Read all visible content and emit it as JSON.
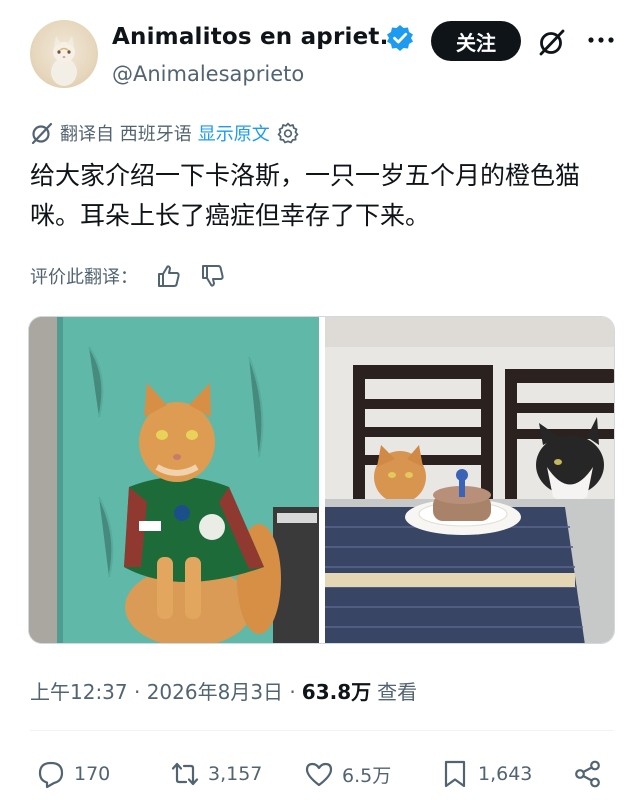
{
  "author": {
    "display_name": "Animalitos en apriet...",
    "handle": "@Animalesaprieto",
    "avatar_icon": "cat-avatar",
    "verified_icon": "verified-badge-icon",
    "follow_label": "关注"
  },
  "translation": {
    "prefix": "翻译自 西班牙语",
    "show_original": "显示原文",
    "rate_label": "评价此翻译："
  },
  "tweet": {
    "text": "给大家介绍一下卡洛斯，一只一岁五个月的橙色猫咪。耳朵上长了癌症但幸存了下来。"
  },
  "meta": {
    "time": "上午12:37 · 2026年8月3日 ·",
    "views": "63.8万",
    "views_label": "查看"
  },
  "actions": {
    "replies": "170",
    "reposts": "3,157",
    "likes": "6.5万",
    "bookmarks": "1,643"
  },
  "colors": {
    "accent": "#1d9bf0",
    "text": "#0f1419",
    "muted": "#536471"
  }
}
